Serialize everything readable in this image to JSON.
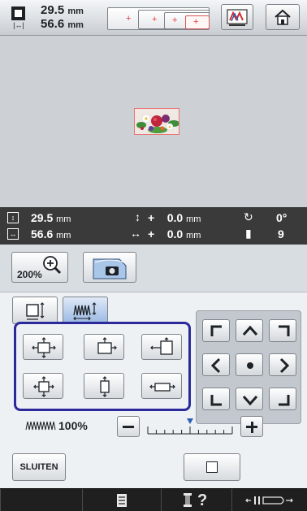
{
  "topbar": {
    "width_value": "29.5",
    "width_unit": "mm",
    "height_value": "56.6",
    "height_unit": "mm",
    "hoop_marker": "+"
  },
  "infobar": {
    "height_value": "29.5",
    "height_unit": "mm",
    "width_value": "56.6",
    "width_unit": "mm",
    "vert_offset_sign": "+",
    "vert_offset_value": "0.0",
    "vert_offset_unit": "mm",
    "horiz_offset_sign": "+",
    "horiz_offset_value": "0.0",
    "horiz_offset_unit": "mm",
    "rotation": "0°",
    "thread_count": "9"
  },
  "zoom": {
    "label": "200%"
  },
  "density": {
    "value": "100%",
    "level_fraction": 0.5
  },
  "close_button": {
    "label": "SLUITEN"
  },
  "colors": {
    "selection_border": "#2a2a9a",
    "info_bar_bg": "#3a3a3a",
    "active_tab": "#9ab9e3",
    "accent_blue": "#2b5fb4"
  },
  "icons": [
    "size-box-icon",
    "hoop-icon",
    "edit-icon",
    "home-icon",
    "zoom-icon",
    "preview-icon",
    "arrow-up-left-icon",
    "arrow-up-icon",
    "arrow-up-right-icon",
    "arrow-left-icon",
    "center-icon",
    "arrow-right-icon",
    "arrow-down-left-icon",
    "arrow-down-icon",
    "arrow-down-right-icon",
    "resize-icon",
    "density-icon",
    "checklist-icon",
    "spool-icon",
    "help-icon",
    "foot-icon"
  ]
}
